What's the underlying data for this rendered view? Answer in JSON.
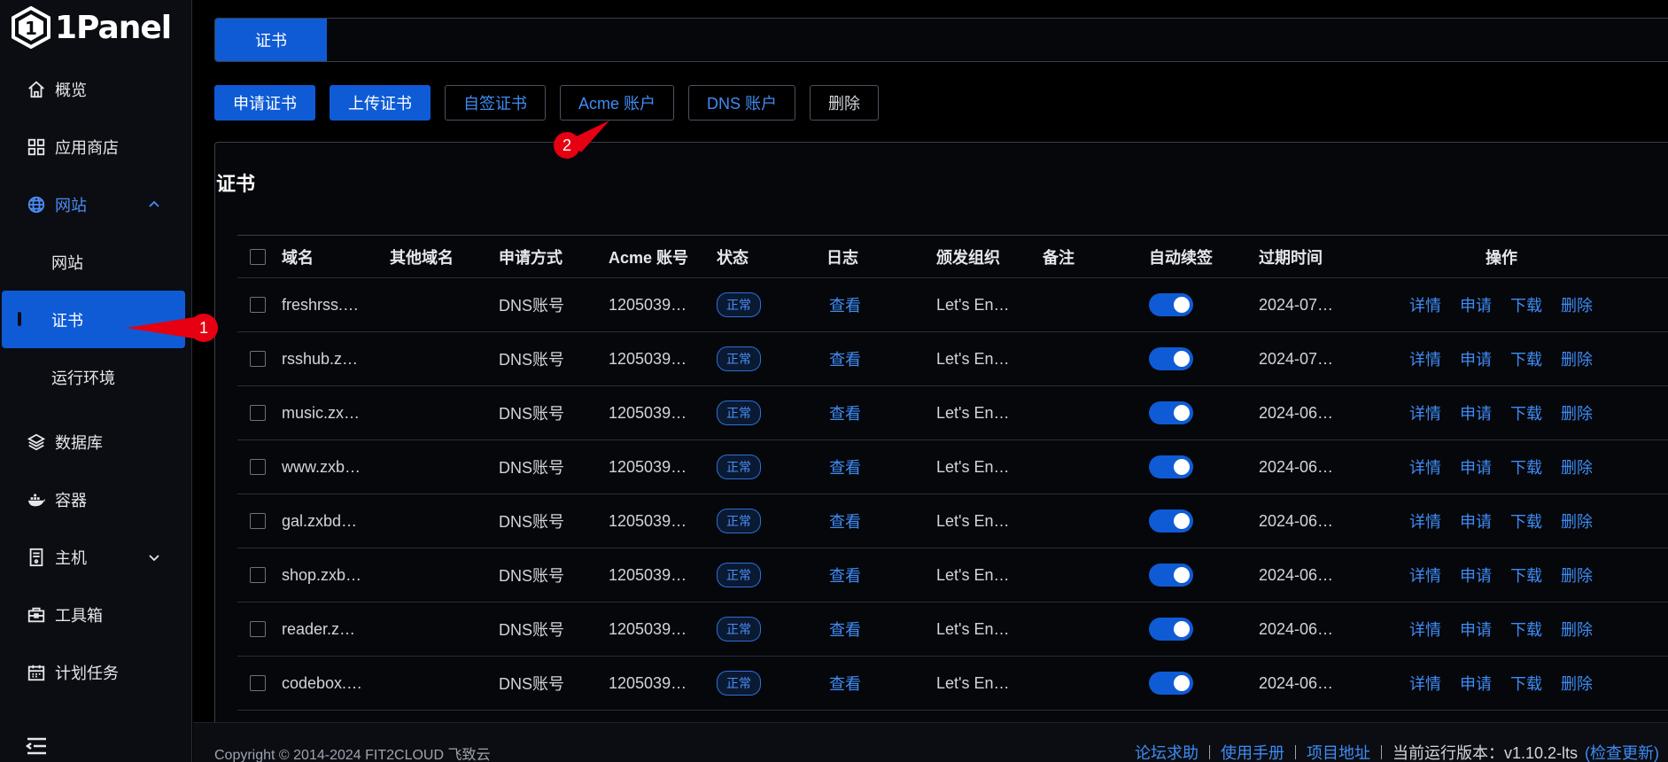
{
  "app": {
    "name": "1Panel"
  },
  "sidebar": {
    "items": [
      {
        "label": "概览",
        "icon": "home-icon"
      },
      {
        "label": "应用商店",
        "icon": "grid-icon"
      },
      {
        "label": "网站",
        "icon": "globe-icon",
        "expanded": true
      },
      {
        "label": "网站",
        "sub": true
      },
      {
        "label": "证书",
        "sub": true,
        "selected": true
      },
      {
        "label": "运行环境",
        "sub": true
      },
      {
        "label": "数据库",
        "icon": "layers-icon"
      },
      {
        "label": "容器",
        "icon": "docker-icon"
      },
      {
        "label": "主机",
        "icon": "server-icon",
        "collapsible": true
      },
      {
        "label": "工具箱",
        "icon": "toolbox-icon"
      },
      {
        "label": "计划任务",
        "icon": "calendar-icon"
      }
    ]
  },
  "tabs": {
    "active": "证书"
  },
  "toolbar": {
    "apply": "申请证书",
    "upload": "上传证书",
    "self_sign": "自签证书",
    "acme": "Acme 账户",
    "dns": "DNS 账户",
    "delete": "删除"
  },
  "card": {
    "title": "证书"
  },
  "table": {
    "headers": [
      "域名",
      "其他域名",
      "申请方式",
      "Acme 账号",
      "状态",
      "日志",
      "颁发组织",
      "备注",
      "自动续签",
      "过期时间",
      "操作"
    ],
    "actions": [
      "详情",
      "申请",
      "下载",
      "删除"
    ],
    "rows": [
      {
        "domain": "freshrss.…",
        "other": "",
        "method": "DNS账号",
        "acme": "1205039…",
        "status": "正常",
        "log": "查看",
        "issuer": "Let's En…",
        "note": "",
        "auto": true,
        "expire": "2024-07…"
      },
      {
        "domain": "rsshub.z…",
        "other": "",
        "method": "DNS账号",
        "acme": "1205039…",
        "status": "正常",
        "log": "查看",
        "issuer": "Let's En…",
        "note": "",
        "auto": true,
        "expire": "2024-07…"
      },
      {
        "domain": "music.zx…",
        "other": "",
        "method": "DNS账号",
        "acme": "1205039…",
        "status": "正常",
        "log": "查看",
        "issuer": "Let's En…",
        "note": "",
        "auto": true,
        "expire": "2024-06…"
      },
      {
        "domain": "www.zxb…",
        "other": "",
        "method": "DNS账号",
        "acme": "1205039…",
        "status": "正常",
        "log": "查看",
        "issuer": "Let's En…",
        "note": "",
        "auto": true,
        "expire": "2024-06…"
      },
      {
        "domain": "gal.zxbd…",
        "other": "",
        "method": "DNS账号",
        "acme": "1205039…",
        "status": "正常",
        "log": "查看",
        "issuer": "Let's En…",
        "note": "",
        "auto": true,
        "expire": "2024-06…"
      },
      {
        "domain": "shop.zxb…",
        "other": "",
        "method": "DNS账号",
        "acme": "1205039…",
        "status": "正常",
        "log": "查看",
        "issuer": "Let's En…",
        "note": "",
        "auto": true,
        "expire": "2024-06…"
      },
      {
        "domain": "reader.z…",
        "other": "",
        "method": "DNS账号",
        "acme": "1205039…",
        "status": "正常",
        "log": "查看",
        "issuer": "Let's En…",
        "note": "",
        "auto": true,
        "expire": "2024-06…"
      },
      {
        "domain": "codebox.…",
        "other": "",
        "method": "DNS账号",
        "acme": "1205039…",
        "status": "正常",
        "log": "查看",
        "issuer": "Let's En…",
        "note": "",
        "auto": true,
        "expire": "2024-06…"
      }
    ]
  },
  "footer": {
    "copyright": "Copyright © 2014-2024 FIT2CLOUD 飞致云",
    "links": [
      "论坛求助",
      "使用手册",
      "项目地址"
    ],
    "version": "当前运行版本：v1.10.2-lts",
    "check_update": "(检查更新)"
  },
  "annotations": {
    "marker1": "1",
    "marker2": "2"
  },
  "colors": {
    "accent": "#0f5bd6",
    "link": "#3f8cf5",
    "annotation": "#e60012",
    "bg": "#000000"
  }
}
